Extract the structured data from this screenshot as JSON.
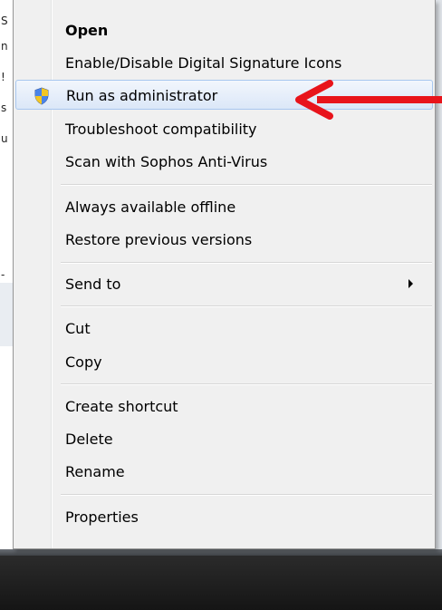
{
  "context_menu": {
    "items": [
      {
        "label": "Open",
        "bold": true
      },
      {
        "label": "Enable/Disable Digital Signature Icons"
      },
      {
        "label": "Run as administrator",
        "icon": "uac-shield-icon",
        "highlighted": true
      },
      {
        "label": "Troubleshoot compatibility"
      },
      {
        "label": "Scan with Sophos Anti-Virus"
      },
      {
        "label": "Always available offline"
      },
      {
        "label": "Restore previous versions"
      },
      {
        "label": "Send to",
        "has_submenu": true
      },
      {
        "label": "Cut"
      },
      {
        "label": "Copy"
      },
      {
        "label": "Create shortcut"
      },
      {
        "label": "Delete"
      },
      {
        "label": "Rename"
      },
      {
        "label": "Properties"
      }
    ]
  },
  "annotation": {
    "icon": "red-arrow-icon",
    "color": "#e8141b",
    "points_to": "Run as administrator"
  },
  "colors": {
    "menu_bg": "#f0f0f0",
    "hover_border": "#a8c7ef",
    "taskbar": "#1c1c1c"
  }
}
